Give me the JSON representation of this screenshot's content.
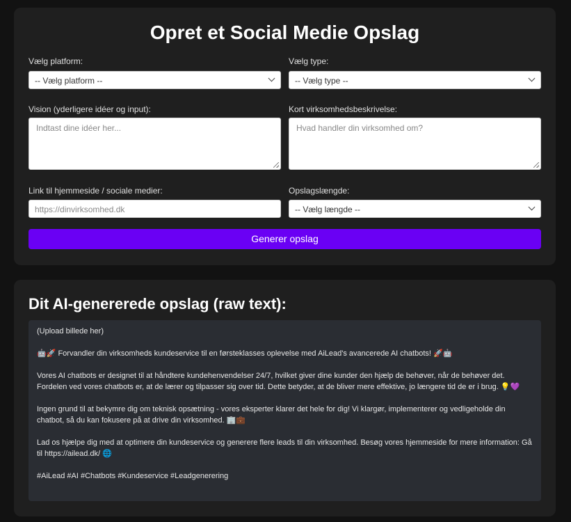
{
  "form": {
    "title": "Opret et Social Medie Opslag",
    "platform": {
      "label": "Vælg platform:",
      "value": "-- Vælg platform --"
    },
    "type": {
      "label": "Vælg type:",
      "value": "-- Vælg type --"
    },
    "vision": {
      "label": "Vision (yderligere idéer og input):",
      "placeholder": "Indtast dine idéer her..."
    },
    "description": {
      "label": "Kort virksomhedsbeskrivelse:",
      "placeholder": "Hvad handler din virksomhed om?"
    },
    "link": {
      "label": "Link til hjemmeside / sociale medier:",
      "placeholder": "https://dinvirksomhed.dk"
    },
    "length": {
      "label": "Opslagslængde:",
      "value": "-- Vælg længde --"
    },
    "generate_label": "Generer opslag"
  },
  "output": {
    "title": "Dit AI-genererede opslag (raw text):",
    "paragraphs": [
      "(Upload billede her)",
      "🤖🚀 Forvandler din virksomheds kundeservice til en førsteklasses oplevelse med AiLead's avancerede AI chatbots! 🚀🤖",
      "Vores AI chatbots er designet til at håndtere kundehenvendelser 24/7, hvilket giver dine kunder den hjælp de behøver, når de behøver det. Fordelen ved vores chatbots er, at de lærer og tilpasser sig over tid. Dette betyder, at de bliver mere effektive, jo længere tid de er i brug. 💡💜",
      "Ingen grund til at bekymre dig om teknisk opsætning - vores eksperter klarer det hele for dig! Vi klargør, implementerer og vedligeholde din chatbot, så du kan fokusere på at drive din virksomhed. 🏢💼",
      "Lad os hjælpe dig med at optimere din kundeservice og generere flere leads til din virksomhed. Besøg vores hjemmeside for mere information: Gå til https://ailead.dk/ 🌐",
      "#AiLead #AI #Chatbots #Kundeservice #Leadgenerering"
    ]
  }
}
